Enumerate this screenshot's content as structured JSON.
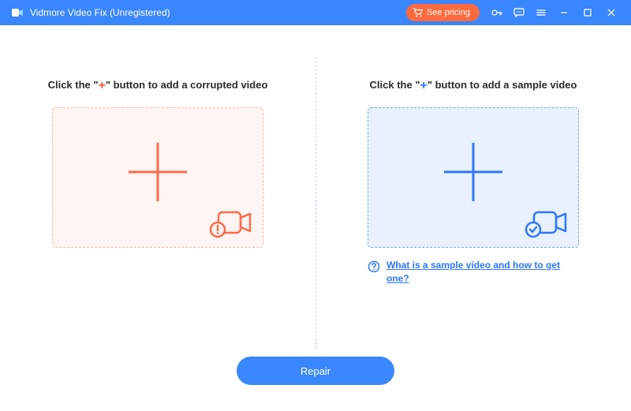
{
  "titlebar": {
    "title": "Vidmore Video Fix (Unregistered)",
    "pricing_label": "See pricing"
  },
  "left": {
    "instr_pre": "Click the \"",
    "instr_post": "\" button to add a corrupted video",
    "plus_symbol": "+"
  },
  "right": {
    "instr_pre": "Click the \"",
    "instr_post": "\" button to add a sample video",
    "plus_symbol": "+",
    "help_text": "What is a sample video and how to get one?"
  },
  "footer": {
    "repair_label": "Repair"
  }
}
